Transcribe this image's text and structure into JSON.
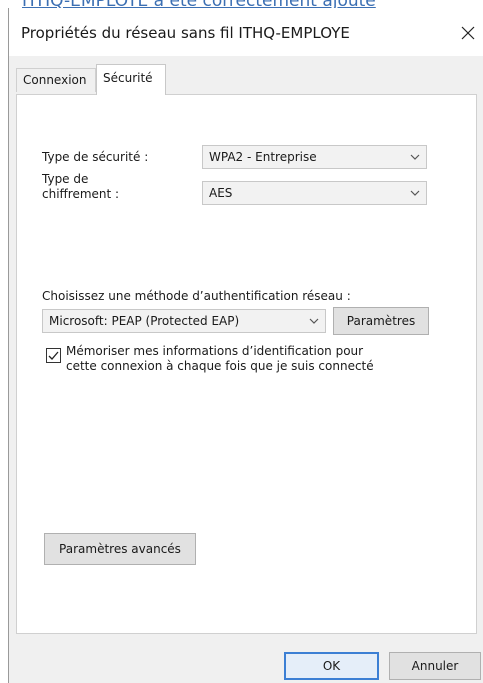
{
  "background_text": "ITHQ-EMPLOYE a été correctement ajouté",
  "window": {
    "title": "Propriétés du réseau sans fil ITHQ-EMPLOYE"
  },
  "tabs": [
    {
      "label": "Connexion",
      "selected": false
    },
    {
      "label": "Sécurité",
      "selected": true
    }
  ],
  "security": {
    "type_label": "Type de sécurité :",
    "type_value": "WPA2 - Entreprise",
    "encryption_label_line1": "Type de",
    "encryption_label_line2": "chiffrement :",
    "encryption_value": "AES"
  },
  "auth": {
    "method_label": "Choisissez une méthode d’authentification réseau :",
    "method_value": "Microsoft: PEAP (Protected EAP)",
    "settings_button": "Paramètres",
    "remember_checked": true,
    "remember_line1": "Mémoriser mes informations d’identification pour",
    "remember_line2": "cette connexion à chaque fois que je suis connecté"
  },
  "advanced_button": "Paramètres avancés",
  "footer": {
    "ok": "OK",
    "cancel": "Annuler"
  },
  "colors": {
    "focus_border": "#3c7fd4",
    "dialog_bg": "#f0f0f0",
    "link_blue": "#3b6fb3"
  },
  "icons": {
    "close": "close-icon",
    "dropdown": "chevron-down-icon",
    "check": "check-icon"
  }
}
